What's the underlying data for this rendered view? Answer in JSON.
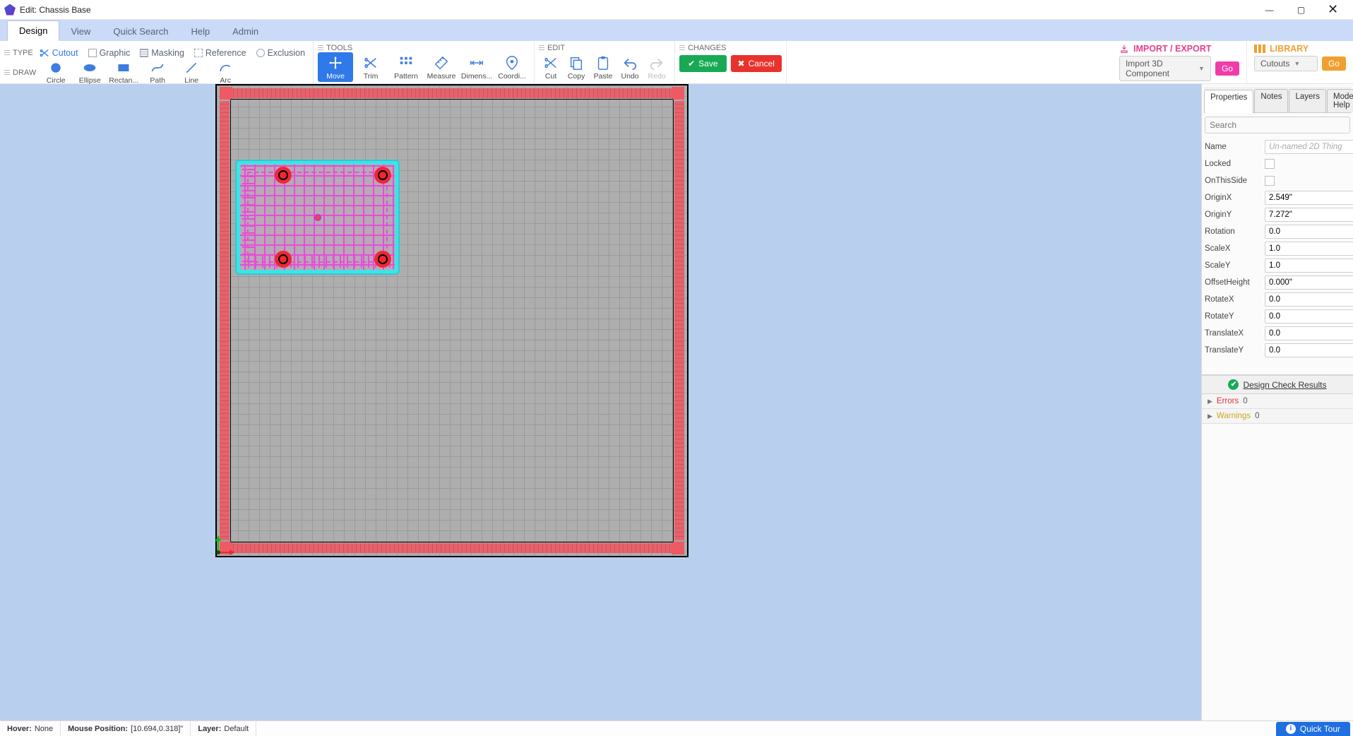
{
  "window": {
    "title": "Edit: Chassis Base"
  },
  "menu": {
    "tabs": [
      "Design",
      "View",
      "Quick Search",
      "Help",
      "Admin"
    ],
    "active": 0
  },
  "ribbon": {
    "type": {
      "label": "TYPE",
      "items": [
        "Cutout",
        "Graphic",
        "Masking",
        "Reference",
        "Exclusion"
      ],
      "active": 0
    },
    "draw": {
      "label": "DRAW",
      "items": [
        "Circle",
        "Ellipse",
        "Rectan...",
        "Path",
        "Line",
        "Arc"
      ]
    },
    "tools": {
      "label": "TOOLS",
      "items": [
        "Move",
        "Trim",
        "Pattern",
        "Measure",
        "Dimens...",
        "Coordi..."
      ],
      "active": 0
    },
    "edit": {
      "label": "EDIT",
      "items": [
        "Cut",
        "Copy",
        "Paste",
        "Undo",
        "Redo"
      ],
      "disabled": [
        4
      ]
    },
    "changes": {
      "label": "CHANGES",
      "save": "Save",
      "cancel": "Cancel"
    },
    "importExport": {
      "label": "IMPORT / EXPORT",
      "dropdown": "Import 3D Component",
      "go": "Go"
    },
    "library": {
      "label": "LIBRARY",
      "dropdown": "Cutouts",
      "go": "Go"
    }
  },
  "rightPanel": {
    "tabs": [
      "Properties",
      "Notes",
      "Layers",
      "Mode Help"
    ],
    "activeTab": 0,
    "searchPlaceholder": "Search",
    "props": {
      "Name": {
        "label": "Name",
        "placeholder": "Un-named 2D Thing"
      },
      "Locked": {
        "label": "Locked"
      },
      "OnThisSide": {
        "label": "OnThisSide"
      },
      "OriginX": {
        "label": "OriginX",
        "value": "2.549\""
      },
      "OriginY": {
        "label": "OriginY",
        "value": "7.272\""
      },
      "Rotation": {
        "label": "Rotation",
        "value": "0.0"
      },
      "ScaleX": {
        "label": "ScaleX",
        "value": "1.0"
      },
      "ScaleY": {
        "label": "ScaleY",
        "value": "1.0"
      },
      "OffsetHeight": {
        "label": "OffsetHeight",
        "value": "0.000\""
      },
      "RotateX": {
        "label": "RotateX",
        "value": "0.0"
      },
      "RotateY": {
        "label": "RotateY",
        "value": "0.0"
      },
      "TranslateX": {
        "label": "TranslateX",
        "value": "0.0"
      },
      "TranslateY": {
        "label": "TranslateY",
        "value": "0.0"
      }
    },
    "check": {
      "title": "Design Check Results",
      "errors": {
        "label": "Errors",
        "count": "0"
      },
      "warnings": {
        "label": "Warnings",
        "count": "0"
      }
    }
  },
  "status": {
    "hoverLabel": "Hover:",
    "hoverVal": "None",
    "mouseLabel": "Mouse Position:",
    "mouseVal": "[10.694,0.318]\"",
    "layerLabel": "Layer:",
    "layerVal": "Default",
    "quickTour": "Quick Tour"
  }
}
